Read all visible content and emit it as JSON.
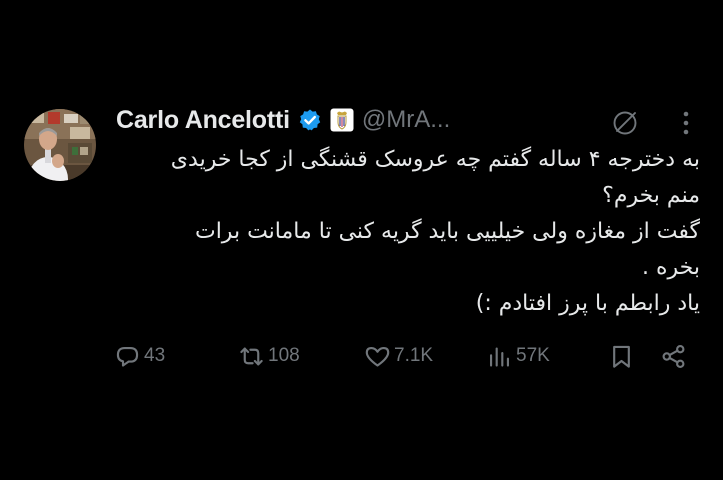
{
  "tweet": {
    "author": {
      "display_name": "Carlo Ancelotti",
      "handle": "@MrA...",
      "verified": true,
      "affiliate_badge": "real-madrid-crest-icon"
    },
    "body_lines": [
      "به دخترجه ۴ ساله گفتم چه عروسک قشنگی از کجا خریدی",
      "منم بخرم؟",
      "گفت از مغازه ولی خیلییی باید گریه کنی تا مامانت برات",
      "بخره .",
      "یاد رابطم با پرز افتادم :)"
    ],
    "actions": {
      "replies": "43",
      "reposts": "108",
      "likes": "7.1K",
      "views": "57K"
    },
    "icons": {
      "grok": "grok-icon",
      "more": "more-icon",
      "reply": "reply-icon",
      "repost": "repost-icon",
      "like": "heart-icon",
      "views": "views-icon",
      "bookmark": "bookmark-icon",
      "share": "share-icon"
    }
  },
  "colors": {
    "background": "#000000",
    "text_primary": "#e7e9ea",
    "text_secondary": "#71767b",
    "verified_blue": "#1d9bf0"
  }
}
